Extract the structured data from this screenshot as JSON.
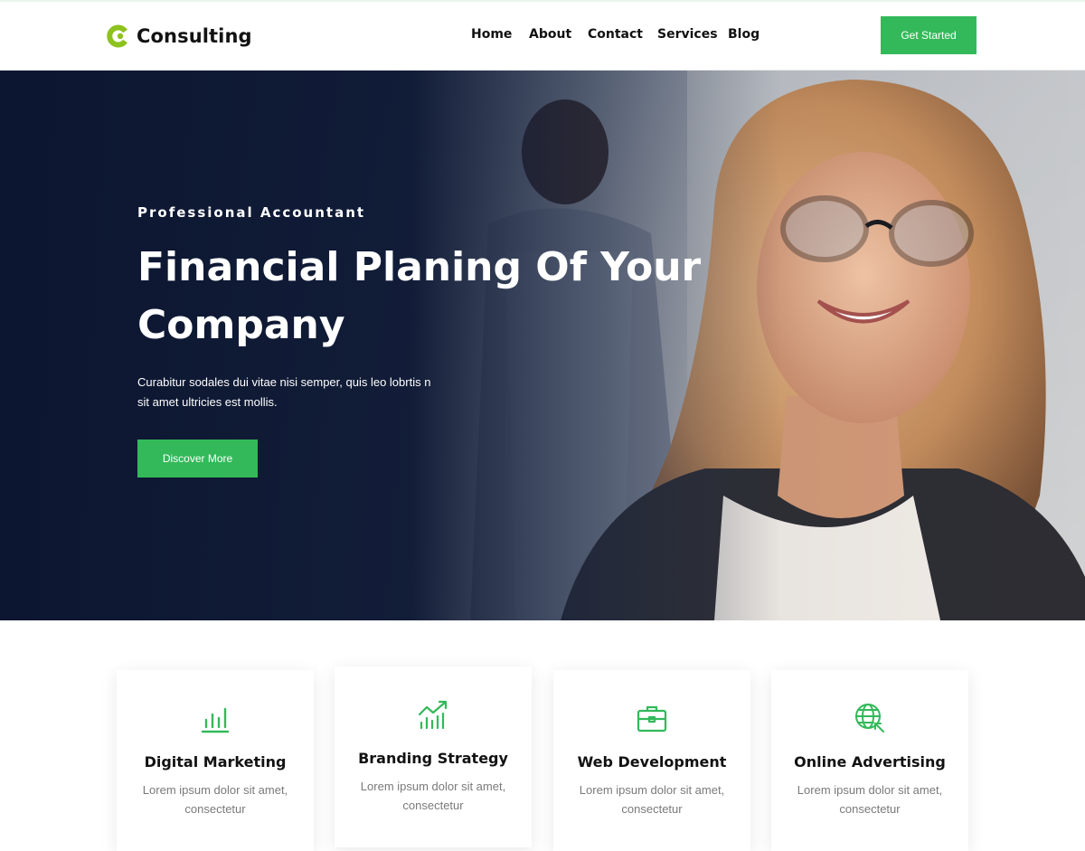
{
  "brand": {
    "name": "Consulting",
    "logo_icon": "c-logo-icon",
    "logo_color": "#8dc21f"
  },
  "nav": {
    "home": "Home",
    "about": "About",
    "contact": "Contact",
    "services": "Services",
    "blog": "Blog"
  },
  "header": {
    "cta_label": "Get Started"
  },
  "hero": {
    "subtitle": "Professional Accountant",
    "title": "Financial Planing Of Your Company",
    "description": "Curabitur sodales dui vitae nisi semper, quis leo lobrtis n sit amet ultricies est mollis.",
    "cta_label": "Discover More"
  },
  "services": [
    {
      "icon": "bar-chart-icon",
      "title": "Digital Marketing",
      "text": "Lorem ipsum dolor sit amet, consectetur"
    },
    {
      "icon": "trending-chart-icon",
      "title": "Branding Strategy",
      "text": "Lorem ipsum dolor sit amet, consectetur"
    },
    {
      "icon": "briefcase-icon",
      "title": "Web Development",
      "text": "Lorem ipsum dolor sit amet, consectetur"
    },
    {
      "icon": "globe-cursor-icon",
      "title": "Online Advertising",
      "text": "Lorem ipsum dolor sit amet, consectetur"
    }
  ],
  "colors": {
    "accent": "#33b95a",
    "hero_dark": "#0c1630",
    "logo": "#8dc21f"
  }
}
